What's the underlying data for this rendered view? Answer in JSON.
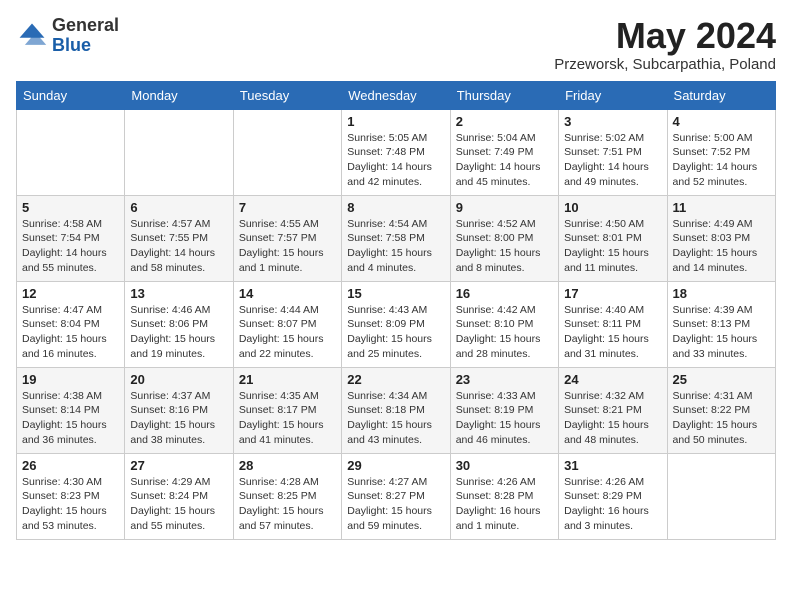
{
  "header": {
    "logo_general": "General",
    "logo_blue": "Blue",
    "month_title": "May 2024",
    "location": "Przeworsk, Subcarpathia, Poland"
  },
  "weekdays": [
    "Sunday",
    "Monday",
    "Tuesday",
    "Wednesday",
    "Thursday",
    "Friday",
    "Saturday"
  ],
  "weeks": [
    [
      {
        "day": "",
        "info": ""
      },
      {
        "day": "",
        "info": ""
      },
      {
        "day": "",
        "info": ""
      },
      {
        "day": "1",
        "info": "Sunrise: 5:05 AM\nSunset: 7:48 PM\nDaylight: 14 hours\nand 42 minutes."
      },
      {
        "day": "2",
        "info": "Sunrise: 5:04 AM\nSunset: 7:49 PM\nDaylight: 14 hours\nand 45 minutes."
      },
      {
        "day": "3",
        "info": "Sunrise: 5:02 AM\nSunset: 7:51 PM\nDaylight: 14 hours\nand 49 minutes."
      },
      {
        "day": "4",
        "info": "Sunrise: 5:00 AM\nSunset: 7:52 PM\nDaylight: 14 hours\nand 52 minutes."
      }
    ],
    [
      {
        "day": "5",
        "info": "Sunrise: 4:58 AM\nSunset: 7:54 PM\nDaylight: 14 hours\nand 55 minutes."
      },
      {
        "day": "6",
        "info": "Sunrise: 4:57 AM\nSunset: 7:55 PM\nDaylight: 14 hours\nand 58 minutes."
      },
      {
        "day": "7",
        "info": "Sunrise: 4:55 AM\nSunset: 7:57 PM\nDaylight: 15 hours\nand 1 minute."
      },
      {
        "day": "8",
        "info": "Sunrise: 4:54 AM\nSunset: 7:58 PM\nDaylight: 15 hours\nand 4 minutes."
      },
      {
        "day": "9",
        "info": "Sunrise: 4:52 AM\nSunset: 8:00 PM\nDaylight: 15 hours\nand 8 minutes."
      },
      {
        "day": "10",
        "info": "Sunrise: 4:50 AM\nSunset: 8:01 PM\nDaylight: 15 hours\nand 11 minutes."
      },
      {
        "day": "11",
        "info": "Sunrise: 4:49 AM\nSunset: 8:03 PM\nDaylight: 15 hours\nand 14 minutes."
      }
    ],
    [
      {
        "day": "12",
        "info": "Sunrise: 4:47 AM\nSunset: 8:04 PM\nDaylight: 15 hours\nand 16 minutes."
      },
      {
        "day": "13",
        "info": "Sunrise: 4:46 AM\nSunset: 8:06 PM\nDaylight: 15 hours\nand 19 minutes."
      },
      {
        "day": "14",
        "info": "Sunrise: 4:44 AM\nSunset: 8:07 PM\nDaylight: 15 hours\nand 22 minutes."
      },
      {
        "day": "15",
        "info": "Sunrise: 4:43 AM\nSunset: 8:09 PM\nDaylight: 15 hours\nand 25 minutes."
      },
      {
        "day": "16",
        "info": "Sunrise: 4:42 AM\nSunset: 8:10 PM\nDaylight: 15 hours\nand 28 minutes."
      },
      {
        "day": "17",
        "info": "Sunrise: 4:40 AM\nSunset: 8:11 PM\nDaylight: 15 hours\nand 31 minutes."
      },
      {
        "day": "18",
        "info": "Sunrise: 4:39 AM\nSunset: 8:13 PM\nDaylight: 15 hours\nand 33 minutes."
      }
    ],
    [
      {
        "day": "19",
        "info": "Sunrise: 4:38 AM\nSunset: 8:14 PM\nDaylight: 15 hours\nand 36 minutes."
      },
      {
        "day": "20",
        "info": "Sunrise: 4:37 AM\nSunset: 8:16 PM\nDaylight: 15 hours\nand 38 minutes."
      },
      {
        "day": "21",
        "info": "Sunrise: 4:35 AM\nSunset: 8:17 PM\nDaylight: 15 hours\nand 41 minutes."
      },
      {
        "day": "22",
        "info": "Sunrise: 4:34 AM\nSunset: 8:18 PM\nDaylight: 15 hours\nand 43 minutes."
      },
      {
        "day": "23",
        "info": "Sunrise: 4:33 AM\nSunset: 8:19 PM\nDaylight: 15 hours\nand 46 minutes."
      },
      {
        "day": "24",
        "info": "Sunrise: 4:32 AM\nSunset: 8:21 PM\nDaylight: 15 hours\nand 48 minutes."
      },
      {
        "day": "25",
        "info": "Sunrise: 4:31 AM\nSunset: 8:22 PM\nDaylight: 15 hours\nand 50 minutes."
      }
    ],
    [
      {
        "day": "26",
        "info": "Sunrise: 4:30 AM\nSunset: 8:23 PM\nDaylight: 15 hours\nand 53 minutes."
      },
      {
        "day": "27",
        "info": "Sunrise: 4:29 AM\nSunset: 8:24 PM\nDaylight: 15 hours\nand 55 minutes."
      },
      {
        "day": "28",
        "info": "Sunrise: 4:28 AM\nSunset: 8:25 PM\nDaylight: 15 hours\nand 57 minutes."
      },
      {
        "day": "29",
        "info": "Sunrise: 4:27 AM\nSunset: 8:27 PM\nDaylight: 15 hours\nand 59 minutes."
      },
      {
        "day": "30",
        "info": "Sunrise: 4:26 AM\nSunset: 8:28 PM\nDaylight: 16 hours\nand 1 minute."
      },
      {
        "day": "31",
        "info": "Sunrise: 4:26 AM\nSunset: 8:29 PM\nDaylight: 16 hours\nand 3 minutes."
      },
      {
        "day": "",
        "info": ""
      }
    ]
  ]
}
